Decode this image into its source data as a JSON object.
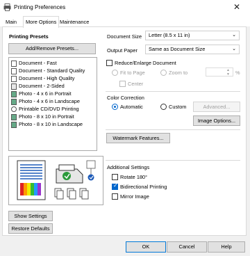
{
  "window": {
    "title": "Printing Preferences"
  },
  "tabs": [
    "Main",
    "More Options",
    "Maintenance"
  ],
  "presets": {
    "heading": "Printing Presets",
    "add_button": "Add/Remove Presets...",
    "items": [
      "Document - Fast",
      "Document - Standard Quality",
      "Document - High Quality",
      "Document - 2-Sided",
      "Photo - 4 x 6 in Portrait",
      "Photo - 4 x 6 in Landscape",
      "Printable CD/DVD Printing",
      "Photo - 8 x 10 in Portrait",
      "Photo - 8 x 10 in Landscape"
    ]
  },
  "left_buttons": {
    "show_settings": "Show Settings",
    "restore_defaults": "Restore Defaults"
  },
  "document_size": {
    "label": "Document Size",
    "value": "Letter (8.5 x 11 in)"
  },
  "output_paper": {
    "label": "Output Paper",
    "value": "Same as Document Size"
  },
  "reduce": {
    "label": "Reduce/Enlarge Document",
    "fit_to_page": "Fit to Page",
    "zoom_to": "Zoom to",
    "percent": "%",
    "center": "Center"
  },
  "color_correction": {
    "heading": "Color Correction",
    "automatic": "Automatic",
    "custom": "Custom",
    "advanced": "Advanced...",
    "image_options": "Image Options..."
  },
  "watermark": "Watermark Features...",
  "additional": {
    "heading": "Additional Settings",
    "rotate": "Rotate 180°",
    "bidirectional": "Bidirectional Printing",
    "mirror": "Mirror Image"
  },
  "footer": {
    "ok": "OK",
    "cancel": "Cancel",
    "help": "Help"
  }
}
